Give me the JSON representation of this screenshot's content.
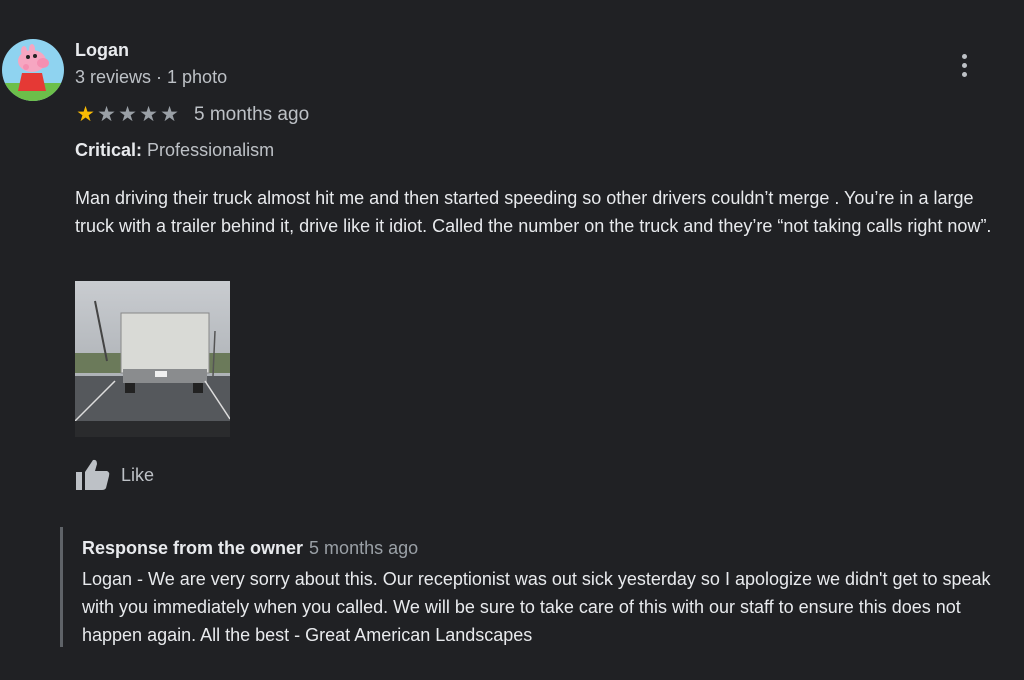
{
  "review": {
    "reviewer_name": "Logan",
    "reviewer_meta": "3 reviews · 1 photo",
    "rating": 1,
    "rating_max": 5,
    "time": "5 months ago",
    "critical_label": "Critical:",
    "critical_value": "Professionalism",
    "text": "Man driving their truck almost hit me and then started speeding so other drivers couldn’t merge . You’re in a large truck with a trailer behind it, drive like it idiot. Called the number on the truck and they’re “not taking calls right now”.",
    "like_label": "Like"
  },
  "owner_response": {
    "title": "Response from the owner",
    "time": "5 months ago",
    "text": "Logan - We are very sorry about this. Our receptionist was out sick yesterday so I apologize we didn't get to speak with you immediately when you called. We will be sure to take care of this with our staff to ensure this does not happen again. All the best - Great American Landscapes"
  },
  "icons": {
    "star": "star-icon",
    "like": "thumbs-up-icon",
    "more": "more-vert-icon"
  },
  "colors": {
    "background": "#202124",
    "star_filled": "#fbbc04",
    "star_empty": "#9aa0a6",
    "text_primary": "#e8eaed",
    "text_secondary": "#bdc1c6"
  }
}
